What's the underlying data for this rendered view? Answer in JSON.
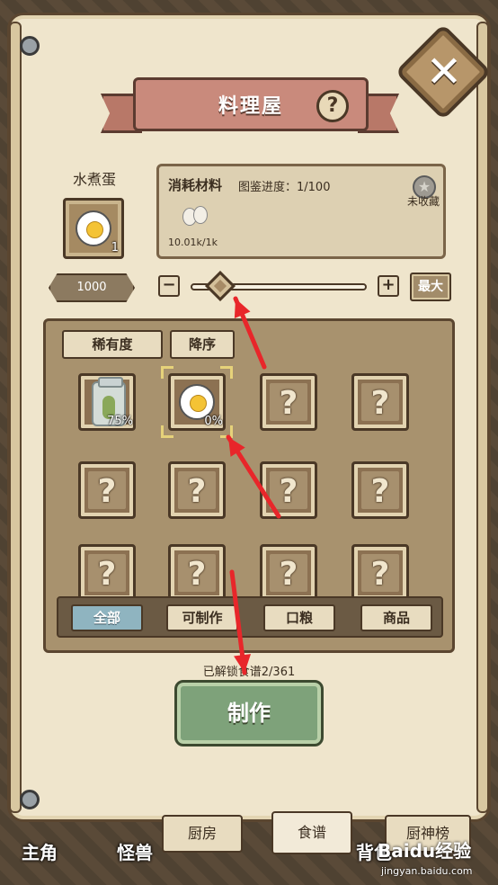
{
  "window": {
    "title": "料理屋",
    "close_icon": "close-icon",
    "help_icon": "question-icon"
  },
  "item": {
    "name": "水煮蛋",
    "count": "1",
    "icon": "boiled-egg-icon"
  },
  "info": {
    "title": "消耗材料",
    "progress": "图鉴进度：1/100",
    "collect_status": "未收藏",
    "material_icon": "eggs-icon",
    "stock": "10.01k/1k"
  },
  "quantity": {
    "value": "1000",
    "minus_label": "−",
    "plus_label": "+",
    "max_label": "最大",
    "slider_fraction": 0.1
  },
  "sort": {
    "rarity_label": "稀有度",
    "order_label": "降序"
  },
  "recipes": [
    {
      "known": true,
      "icon": "pickle-jar-icon",
      "progress": "75%"
    },
    {
      "known": true,
      "icon": "boiled-egg-icon",
      "progress": "0%",
      "selected": true
    },
    {
      "known": false,
      "label": "?"
    },
    {
      "known": false,
      "label": "?"
    },
    {
      "known": false,
      "label": "?"
    },
    {
      "known": false,
      "label": "?"
    },
    {
      "known": false,
      "label": "?"
    },
    {
      "known": false,
      "label": "?"
    },
    {
      "known": false,
      "label": "?"
    },
    {
      "known": false,
      "label": "?"
    },
    {
      "known": false,
      "label": "?"
    },
    {
      "known": false,
      "label": "?"
    }
  ],
  "filters": [
    {
      "label": "全部",
      "active": true
    },
    {
      "label": "可制作",
      "active": false
    },
    {
      "label": "口粮",
      "active": false
    },
    {
      "label": "商品",
      "active": false
    }
  ],
  "unlock_text": "已解锁食谱2/361",
  "make_button": "制作",
  "tabs": [
    {
      "label": "厨房",
      "active": false
    },
    {
      "label": "食谱",
      "active": true
    },
    {
      "label": "厨神榜",
      "active": false
    }
  ],
  "bottom_nav": [
    "主角",
    "怪兽",
    "背包"
  ],
  "watermark": {
    "brand": "Baidu经验",
    "url": "jingyan.baidu.com"
  },
  "annotation_color": "#e8262a"
}
